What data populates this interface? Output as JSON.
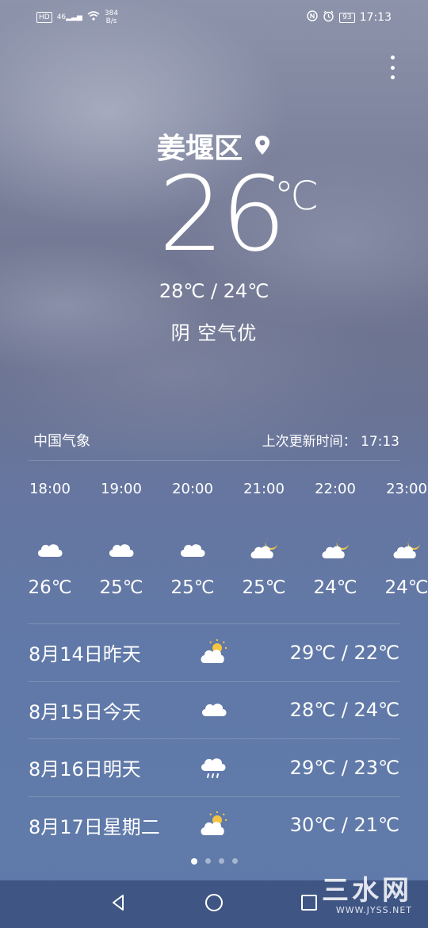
{
  "status_bar": {
    "network_badge": "HD",
    "signal": "46",
    "speed": "384",
    "speed_unit": "B/s",
    "battery": "93",
    "time": "17:13"
  },
  "location": {
    "name": "姜堰区"
  },
  "current": {
    "temperature": "26",
    "unit": "℃",
    "range": "28℃ / 24℃",
    "condition": "阴  空气优"
  },
  "source": {
    "name": "中国气象",
    "updated_label": "上次更新时间：",
    "updated_time": "17:13"
  },
  "hourly": [
    {
      "time": "18:00",
      "icon": "cloud-icon",
      "temp": "26℃"
    },
    {
      "time": "19:00",
      "icon": "cloud-icon",
      "temp": "25℃"
    },
    {
      "time": "20:00",
      "icon": "cloud-icon",
      "temp": "25℃"
    },
    {
      "time": "21:00",
      "icon": "cloudy-night-icon",
      "temp": "25℃"
    },
    {
      "time": "22:00",
      "icon": "cloudy-night-icon",
      "temp": "24℃"
    },
    {
      "time": "23:00",
      "icon": "cloudy-night-icon",
      "temp": "24℃"
    }
  ],
  "daily": [
    {
      "label": "8月14日昨天",
      "icon": "partly-cloudy-icon",
      "range": "29℃ / 22℃"
    },
    {
      "label": "8月15日今天",
      "icon": "cloud-icon",
      "range": "28℃ / 24℃"
    },
    {
      "label": "8月16日明天",
      "icon": "rain-icon",
      "range": "29℃ / 23℃"
    },
    {
      "label": "8月17日星期二",
      "icon": "partly-cloudy-icon",
      "range": "30℃ / 21℃"
    }
  ],
  "pager": {
    "count": 4,
    "active": 0
  },
  "watermark": {
    "main": "三水网",
    "sub": "WWW.JYSS.NET"
  },
  "colors": {
    "background": "#5f7aaa",
    "nav_bar": "#3f5584",
    "text": "#ffffff",
    "sun": "#f5c542",
    "moon": "#f5c542"
  }
}
